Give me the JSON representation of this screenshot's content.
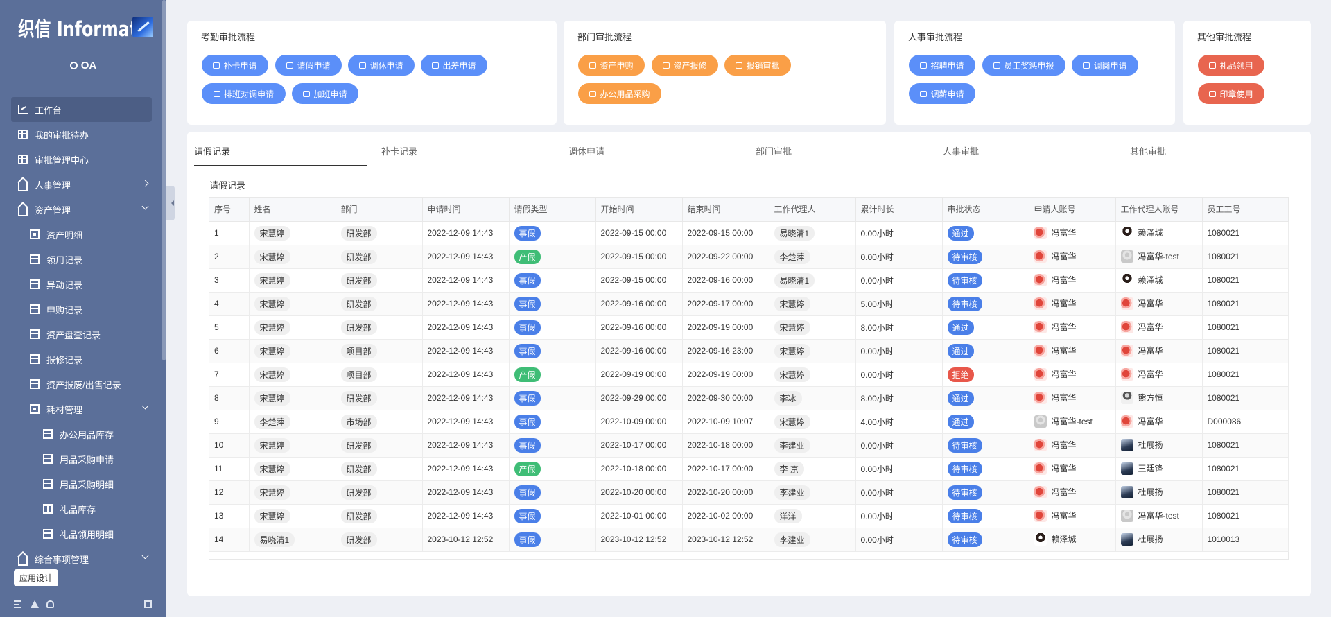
{
  "app": {
    "logo_text": "织信 Informat",
    "user": "OA"
  },
  "sidebar": {
    "items": [
      {
        "label": "工作台",
        "icon": "chart-icon",
        "level": 1,
        "active": true
      },
      {
        "label": "我的审批待办",
        "icon": "grid-icon",
        "level": 1
      },
      {
        "label": "审批管理中心",
        "icon": "grid-icon",
        "level": 1
      },
      {
        "label": "人事管理",
        "icon": "home-icon",
        "level": 1,
        "chevron": "right"
      },
      {
        "label": "资产管理",
        "icon": "home-icon",
        "level": 1,
        "chevron": "down"
      },
      {
        "label": "资产明细",
        "icon": "box-icon",
        "level": 2
      },
      {
        "label": "领用记录",
        "icon": "table-icon",
        "level": 2
      },
      {
        "label": "异动记录",
        "icon": "table-icon",
        "level": 2
      },
      {
        "label": "申购记录",
        "icon": "table-icon",
        "level": 2
      },
      {
        "label": "资产盘查记录",
        "icon": "table-icon",
        "level": 2
      },
      {
        "label": "报修记录",
        "icon": "table-icon",
        "level": 2
      },
      {
        "label": "资产报废/出售记录",
        "icon": "table-icon",
        "level": 2
      },
      {
        "label": "耗材管理",
        "icon": "box-icon",
        "level": 2,
        "chevron": "down"
      },
      {
        "label": "办公用品库存",
        "icon": "table-icon",
        "level": 3
      },
      {
        "label": "用品采购申请",
        "icon": "table-icon",
        "level": 3
      },
      {
        "label": "用品采购明细",
        "icon": "table-icon",
        "level": 3
      },
      {
        "label": "礼品库存",
        "icon": "gift-icon",
        "level": 3
      },
      {
        "label": "礼品领用明细",
        "icon": "table-icon",
        "level": 3
      },
      {
        "label": "综合事项管理",
        "icon": "home-icon",
        "level": 1,
        "chevron": "down"
      }
    ],
    "app_design": "应用设计"
  },
  "cards": [
    {
      "title": "考勤审批流程",
      "buttons": [
        "补卡申请",
        "请假申请",
        "调休申请",
        "出差申请",
        "排班对调申请",
        "加班申请"
      ]
    },
    {
      "title": "部门审批流程",
      "buttons": [
        "资产申购",
        "资产报修",
        "报销审批",
        "办公用品采购"
      ]
    },
    {
      "title": "人事审批流程",
      "buttons": [
        "招聘申请",
        "员工奖惩申报",
        "调岗申请",
        "调薪申请"
      ]
    },
    {
      "title": "其他审批流程",
      "buttons": [
        "礼品领用",
        "印章使用"
      ]
    }
  ],
  "tabs": [
    "请假记录",
    "补卡记录",
    "调休申请",
    "部门审批",
    "人事审批",
    "其他审批"
  ],
  "section_title": "请假记录",
  "table": {
    "columns": [
      "序号",
      "姓名",
      "部门",
      "申请时间",
      "请假类型",
      "开始时间",
      "结束时间",
      "工作代理人",
      "累计时长",
      "审批状态",
      "申请人账号",
      "工作代理人账号",
      "员工工号"
    ],
    "rows": [
      [
        "1",
        "宋慧婷",
        "研发部",
        "2022-12-09 14:43",
        "事假",
        "2022-09-15 00:00",
        "2022-09-15 00:00",
        "易晓清1",
        "0.00小时",
        "通过",
        "冯富华",
        "赖泽城",
        "1080021"
      ],
      [
        "2",
        "宋慧婷",
        "研发部",
        "2022-12-09 14:43",
        "产假",
        "2022-09-15 00:00",
        "2022-09-22 00:00",
        "李楚萍",
        "0.00小时",
        "待审核",
        "冯富华",
        "冯富华-test",
        "1080021"
      ],
      [
        "3",
        "宋慧婷",
        "研发部",
        "2022-12-09 14:43",
        "事假",
        "2022-09-15 00:00",
        "2022-09-16 00:00",
        "易晓清1",
        "0.00小时",
        "待审核",
        "冯富华",
        "赖泽城",
        "1080021"
      ],
      [
        "4",
        "宋慧婷",
        "研发部",
        "2022-12-09 14:43",
        "事假",
        "2022-09-16 00:00",
        "2022-09-17 00:00",
        "宋慧婷",
        "5.00小时",
        "待审核",
        "冯富华",
        "冯富华",
        "1080021"
      ],
      [
        "5",
        "宋慧婷",
        "研发部",
        "2022-12-09 14:43",
        "事假",
        "2022-09-16 00:00",
        "2022-09-19 00:00",
        "宋慧婷",
        "8.00小时",
        "通过",
        "冯富华",
        "冯富华",
        "1080021"
      ],
      [
        "6",
        "宋慧婷",
        "项目部",
        "2022-12-09 14:43",
        "事假",
        "2022-09-16 00:00",
        "2022-09-16 23:00",
        "宋慧婷",
        "0.00小时",
        "通过",
        "冯富华",
        "冯富华",
        "1080021"
      ],
      [
        "7",
        "宋慧婷",
        "项目部",
        "2022-12-09 14:43",
        "产假",
        "2022-09-19 00:00",
        "2022-09-19 00:00",
        "宋慧婷",
        "0.00小时",
        "拒绝",
        "冯富华",
        "冯富华",
        "1080021"
      ],
      [
        "8",
        "宋慧婷",
        "研发部",
        "2022-12-09 14:43",
        "事假",
        "2022-09-29 00:00",
        "2022-09-30 00:00",
        "李冰",
        "8.00小时",
        "通过",
        "冯富华",
        "熊方恒",
        "1080021"
      ],
      [
        "9",
        "李楚萍",
        "市场部",
        "2022-12-09 14:43",
        "事假",
        "2022-10-09 00:00",
        "2022-10-09 10:07",
        "宋慧婷",
        "4.00小时",
        "通过",
        "冯富华-test",
        "冯富华",
        "D000086"
      ],
      [
        "10",
        "宋慧婷",
        "研发部",
        "2022-12-09 14:43",
        "事假",
        "2022-10-17 00:00",
        "2022-10-18 00:00",
        "李建业",
        "0.00小时",
        "待审核",
        "冯富华",
        "杜展扬",
        "1080021"
      ],
      [
        "11",
        "宋慧婷",
        "研发部",
        "2022-12-09 14:43",
        "产假",
        "2022-10-18 00:00",
        "2022-10-17 00:00",
        "李 京",
        "0.00小时",
        "待审核",
        "冯富华",
        "王廷锋",
        "1080021"
      ],
      [
        "12",
        "宋慧婷",
        "研发部",
        "2022-12-09 14:43",
        "事假",
        "2022-10-20 00:00",
        "2022-10-20 00:00",
        "李建业",
        "0.00小时",
        "待审核",
        "冯富华",
        "杜展扬",
        "1080021"
      ],
      [
        "13",
        "宋慧婷",
        "研发部",
        "2022-12-09 14:43",
        "事假",
        "2022-10-01 00:00",
        "2022-10-02 00:00",
        "洋洋",
        "0.00小时",
        "待审核",
        "冯富华",
        "冯富华-test",
        "1080021"
      ],
      [
        "14",
        "易晓清1",
        "研发部",
        "2023-10-12 12:52",
        "事假",
        "2023-10-12 12:52",
        "2023-10-12 12:52",
        "李建业",
        "0.00小时",
        "待审核",
        "赖泽城",
        "杜展扬",
        "1010013"
      ]
    ]
  },
  "colors": {
    "sidebar_bg": "#5b6f99",
    "flow_blue": "#5b8ff9",
    "flow_orange": "#fa9f47",
    "flow_red": "#e8654f",
    "tag_blue": "#4a7fe8",
    "tag_green": "#3fbd76",
    "tag_red": "#e8574a"
  }
}
